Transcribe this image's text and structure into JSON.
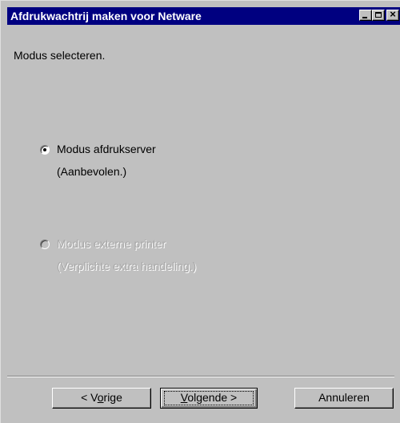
{
  "window": {
    "title": "Afdrukwachtrij maken voor Netware",
    "close_glyph": "×"
  },
  "heading": "Modus selecteren.",
  "options": [
    {
      "label": "Modus afdrukserver",
      "sublabel": "(Aanbevolen.)",
      "selected": true,
      "enabled": true
    },
    {
      "label": "Modus externe printer",
      "sublabel": "(Verplichte extra handeling.)",
      "selected": false,
      "enabled": false
    }
  ],
  "buttons": {
    "prev": {
      "prefix": "< V",
      "accel": "o",
      "suffix": "rige"
    },
    "next": {
      "prefix": "",
      "accel": "V",
      "suffix": "olgende >"
    },
    "cancel": {
      "label": "Annuleren"
    }
  },
  "colors": {
    "titlebar": "#000080",
    "face": "#c0c0c0"
  }
}
